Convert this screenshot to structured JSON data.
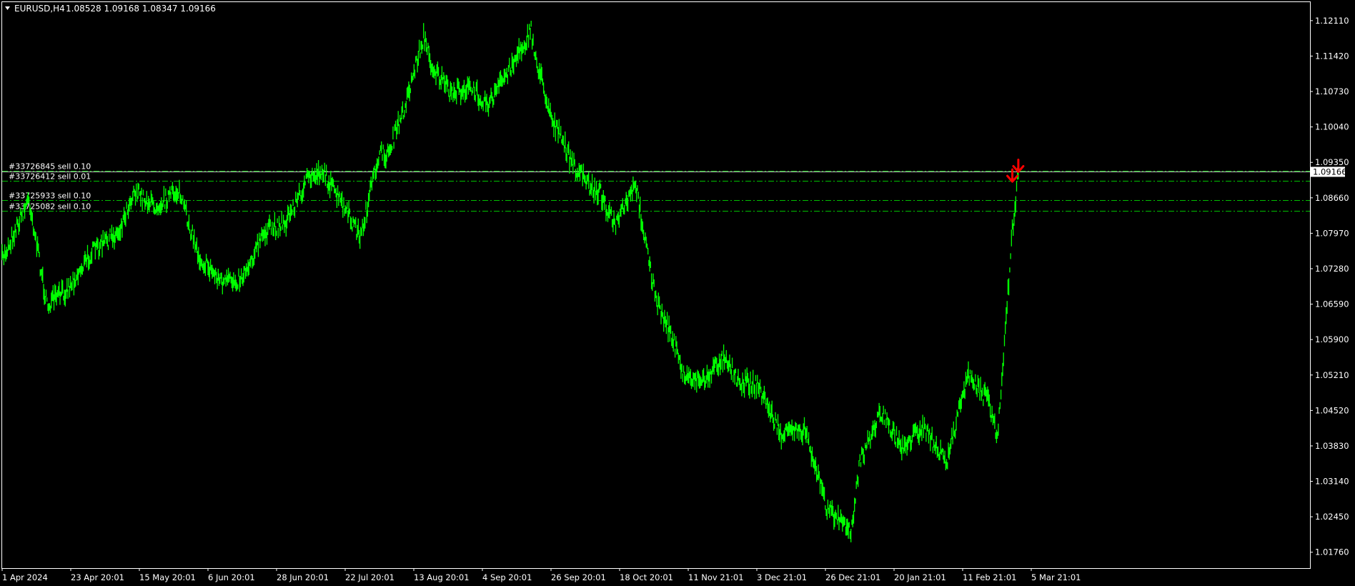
{
  "header": {
    "symbol": "EURUSD,H4",
    "ohlc": "1.08528 1.09168 1.08347 1.09166"
  },
  "colors": {
    "background": "#000000",
    "candle": "#00ff00",
    "axis": "#ffffff",
    "bid_line": "#c0c0c0",
    "order_line": "#00c000",
    "arrow": "#ff0000"
  },
  "orders": [
    {
      "label": "#33726845 sell 0.10",
      "price": 1.0918
    },
    {
      "label": "#33726412 sell 0.01",
      "price": 1.0899
    },
    {
      "label": "#33725933 sell 0.10",
      "price": 1.0861
    },
    {
      "label": "#33725082 sell 0.10",
      "price": 1.0841
    }
  ],
  "current_price": {
    "label": "1.09166",
    "value": 1.09166
  },
  "chart_data": {
    "type": "line",
    "title": "",
    "xlabel": "",
    "ylabel": "",
    "ylim": [
      1.0145,
      1.1247
    ],
    "grid": false,
    "y_ticks": [
      "1.12110",
      "1.11420",
      "1.10730",
      "1.10040",
      "1.09350",
      "1.08660",
      "1.07970",
      "1.07280",
      "1.06590",
      "1.05900",
      "1.05210",
      "1.04520",
      "1.03830",
      "1.03140",
      "1.02450",
      "1.01760"
    ],
    "x_ticks": [
      "1 Apr 2024",
      "23 Apr 20:01",
      "15 May 20:01",
      "6 Jun 20:01",
      "28 Jun 20:01",
      "22 Jul 20:01",
      "13 Aug 20:01",
      "4 Sep 20:01",
      "26 Sep 20:01",
      "18 Oct 20:01",
      "11 Nov 21:01",
      "3 Dec 21:01",
      "26 Dec 21:01",
      "20 Jan 21:01",
      "11 Feb 21:01",
      "5 Mar 21:01"
    ],
    "series": [
      {
        "x": [
          "1 Apr 2024",
          "10 Apr 2024",
          "16 Apr 2024",
          "23 Apr 2024",
          "1 May 2024",
          "10 May 2024",
          "15 May 2024",
          "22 May 2024",
          "30 May 2024",
          "6 Jun 2024",
          "14 Jun 2024",
          "20 Jun 2024",
          "28 Jun 2024",
          "5 Jul 2024",
          "12 Jul 2024",
          "17 Jul 2024",
          "22 Jul 2024",
          "30 Jul 2024",
          "5 Aug 2024",
          "8 Aug 2024",
          "13 Aug 2024",
          "20 Aug 2024",
          "23 Aug 2024",
          "29 Aug 2024",
          "4 Sep 2024",
          "11 Sep 2024",
          "18 Sep 2024",
          "25 Sep 2024",
          "26 Sep 2024",
          "2 Oct 2024",
          "9 Oct 2024",
          "16 Oct 2024",
          "18 Oct 2024",
          "23 Oct 2024",
          "30 Oct 2024",
          "6 Nov 2024",
          "11 Nov 2024",
          "15 Nov 2024",
          "22 Nov 2024",
          "29 Nov 2024",
          "3 Dec 2024",
          "10 Dec 2024",
          "18 Dec 2024",
          "23 Dec 2024",
          "26 Dec 2024",
          "2 Jan 2025",
          "10 Jan 2025",
          "13 Jan 2025",
          "20 Jan 2025",
          "27 Jan 2025",
          "3 Feb 2025",
          "11 Feb 2025",
          "18 Feb 2025",
          "25 Feb 2025",
          "28 Feb 2025",
          "5 Mar 2025",
          "7 Mar 2025"
        ],
        "values": [
          1.0745,
          1.0865,
          1.0655,
          1.069,
          1.076,
          1.08,
          1.088,
          1.085,
          1.088,
          1.075,
          1.07,
          1.071,
          1.08,
          1.082,
          1.09,
          1.092,
          1.087,
          1.079,
          1.095,
          1.095,
          1.103,
          1.118,
          1.112,
          1.107,
          1.108,
          1.105,
          1.112,
          1.119,
          1.115,
          1.102,
          1.093,
          1.088,
          1.088,
          1.081,
          1.089,
          1.066,
          1.06,
          1.052,
          1.051,
          1.056,
          1.051,
          1.05,
          1.04,
          1.042,
          1.041,
          1.026,
          1.022,
          1.035,
          1.045,
          1.038,
          1.042,
          1.035,
          1.052,
          1.047,
          1.04,
          1.08,
          1.0916
        ]
      }
    ],
    "markers": [
      {
        "type": "sell-arrow",
        "x": "5 Mar 2025",
        "y": 1.0899
      },
      {
        "type": "sell-arrow",
        "x": "7 Mar 2025",
        "y": 1.0918
      }
    ]
  }
}
